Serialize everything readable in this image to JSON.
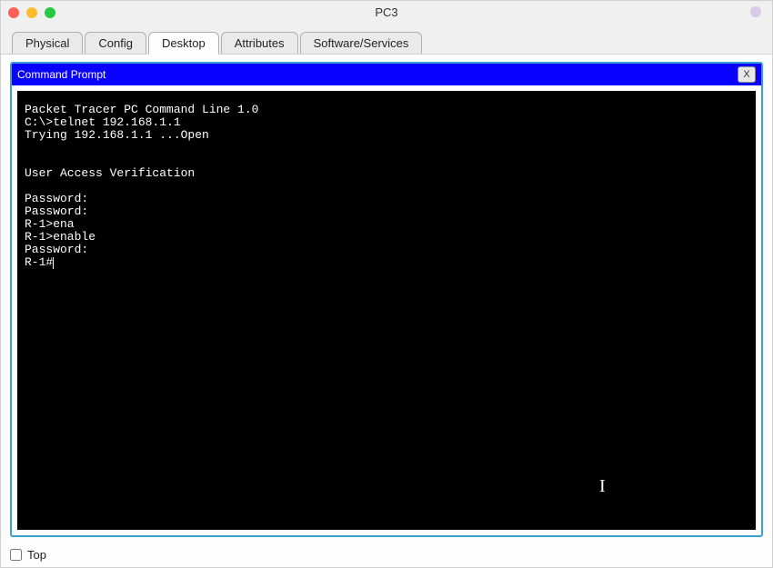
{
  "window": {
    "title": "PC3"
  },
  "tabs": {
    "physical": "Physical",
    "config": "Config",
    "desktop": "Desktop",
    "attributes": "Attributes",
    "software": "Software/Services",
    "active_index": 2
  },
  "command_prompt": {
    "title": "Command Prompt",
    "close_label": "X"
  },
  "terminal": {
    "lines": [
      "Packet Tracer PC Command Line 1.0",
      "C:\\>telnet 192.168.1.1",
      "Trying 192.168.1.1 ...Open",
      "",
      "",
      "User Access Verification",
      "",
      "Password: ",
      "Password: ",
      "R-1>ena",
      "R-1>enable",
      "Password: ",
      "R-1#"
    ]
  },
  "footer": {
    "top_label": "Top",
    "top_checked": false
  }
}
